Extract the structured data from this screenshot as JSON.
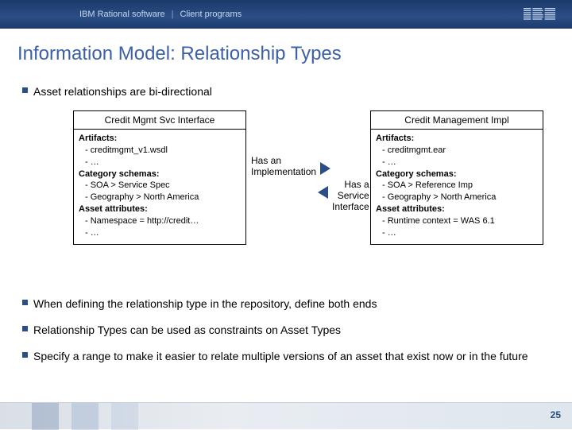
{
  "header": {
    "brand": "IBM Rational software",
    "section": "Client programs",
    "separator": "|"
  },
  "title": "Information Model: Relationship Types",
  "top_bullet": "Asset relationships are bi-directional",
  "diagram": {
    "assetA": {
      "title": "Credit Mgmt Svc Interface",
      "artifacts_hdr": "Artifacts:",
      "artifact_1": "- creditmgmt_v1.wsdl",
      "artifact_2": "- …",
      "cat_hdr": "Category schemas:",
      "cat_1": "- SOA > Service Spec",
      "cat_2": "- Geography > North America",
      "attr_hdr": "Asset attributes:",
      "attr_1": "- Namespace = http://credit…",
      "attr_2": "- …"
    },
    "assetB": {
      "title": "Credit Management Impl",
      "artifacts_hdr": "Artifacts:",
      "artifact_1": "- creditmgmt.ear",
      "artifact_2": "- …",
      "cat_hdr": "Category schemas:",
      "cat_1": "- SOA > Reference Imp",
      "cat_2": "- Geography > North America",
      "attr_hdr": "Asset attributes:",
      "attr_1": "- Runtime context = WAS 6.1",
      "attr_2": "- …"
    },
    "rel_forward_line1": "Has an",
    "rel_forward_line2": "Implementation",
    "rel_back_line1": "Has a",
    "rel_back_line2": "Service",
    "rel_back_line3": "Interface"
  },
  "lower_bullets": {
    "b1": "When defining the relationship type in the repository, define both ends",
    "b2": "Relationship Types can be used as constraints on Asset Types",
    "b3": "Specify a range to make it easier to relate multiple versions of an asset that exist now or in the future"
  },
  "page_number": "25"
}
